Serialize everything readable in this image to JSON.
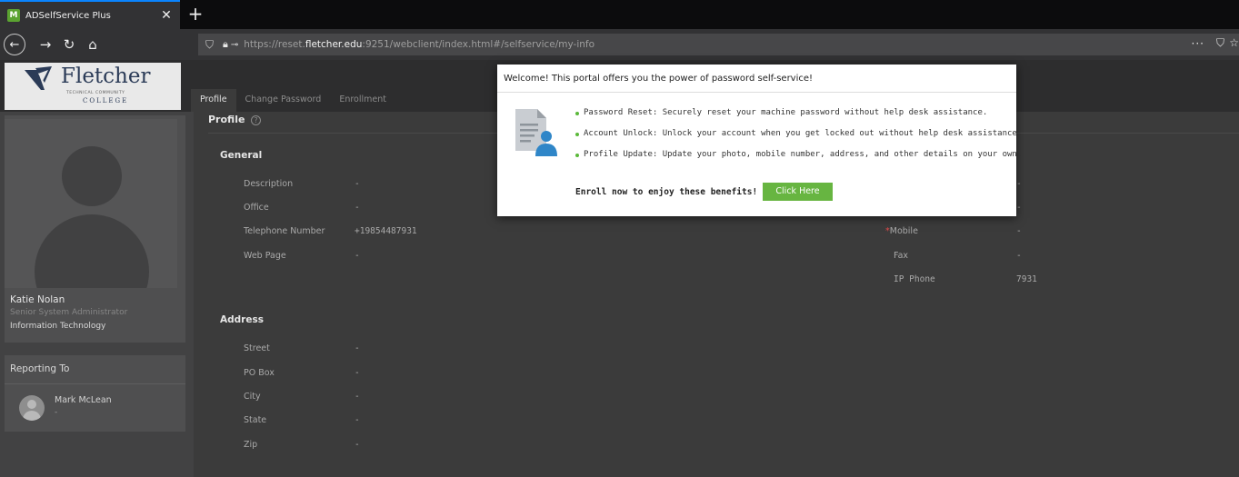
{
  "browser": {
    "tab_title": "ADSelfService Plus",
    "tab_close": "✕",
    "new_tab": "+",
    "url_prefix": "https://reset.",
    "url_domain": "fletcher.edu",
    "url_suffix": ":9251/webclient/index.html#/selfservice/my-info"
  },
  "logo": {
    "name": "Fletcher",
    "subtitle": "TECHNICAL COMMUNITY",
    "college": "COLLEGE"
  },
  "app_tabs": [
    {
      "label": "Profile",
      "active": true
    },
    {
      "label": "Change Password",
      "active": false
    },
    {
      "label": "Enrollment",
      "active": false
    }
  ],
  "user": {
    "name": "Katie Nolan",
    "title": "Senior System Administrator",
    "department": "Information Technology"
  },
  "reporting": {
    "heading": "Reporting To",
    "manager_name": "Mark McLean",
    "manager_sub": "-"
  },
  "main": {
    "title": "Profile",
    "help": "?",
    "general": {
      "heading": "General",
      "fields": [
        {
          "label": "Description",
          "value": "-"
        },
        {
          "label": "Office",
          "value": "-"
        },
        {
          "label": "Telephone Number",
          "value": "+19854487931"
        },
        {
          "label": "Web Page",
          "value": "-"
        }
      ],
      "right_fields": [
        {
          "label": "",
          "value": "-"
        },
        {
          "label": "",
          "value": "-"
        },
        {
          "label": "Mobile",
          "value": "-",
          "required": true
        },
        {
          "label": "Fax",
          "value": "-"
        },
        {
          "label": "IP Phone",
          "value": "7931"
        }
      ]
    },
    "address": {
      "heading": "Address",
      "fields": [
        {
          "label": "Street",
          "value": "-"
        },
        {
          "label": "PO Box",
          "value": "-"
        },
        {
          "label": "City",
          "value": "-"
        },
        {
          "label": "State",
          "value": "-"
        },
        {
          "label": "Zip",
          "value": "-"
        }
      ]
    }
  },
  "modal": {
    "heading": "Welcome! This portal offers you the power of password self-service!",
    "benefits": [
      "Password Reset: Securely reset your machine password without help desk assistance.",
      "Account Unlock: Unlock your account when you get locked out without help desk assistance.",
      "Profile Update: Update your photo, mobile number, address, and other details on your own."
    ],
    "enroll_text": "Enroll now to enjoy these benefits!",
    "button_label": "Click Here",
    "accent": "#67b541"
  },
  "icons": {
    "back": "back-arrow-icon",
    "forward": "forward-arrow-icon",
    "reload": "reload-icon",
    "home": "home-icon",
    "shield": "shield-icon",
    "lock": "lock-icon"
  }
}
